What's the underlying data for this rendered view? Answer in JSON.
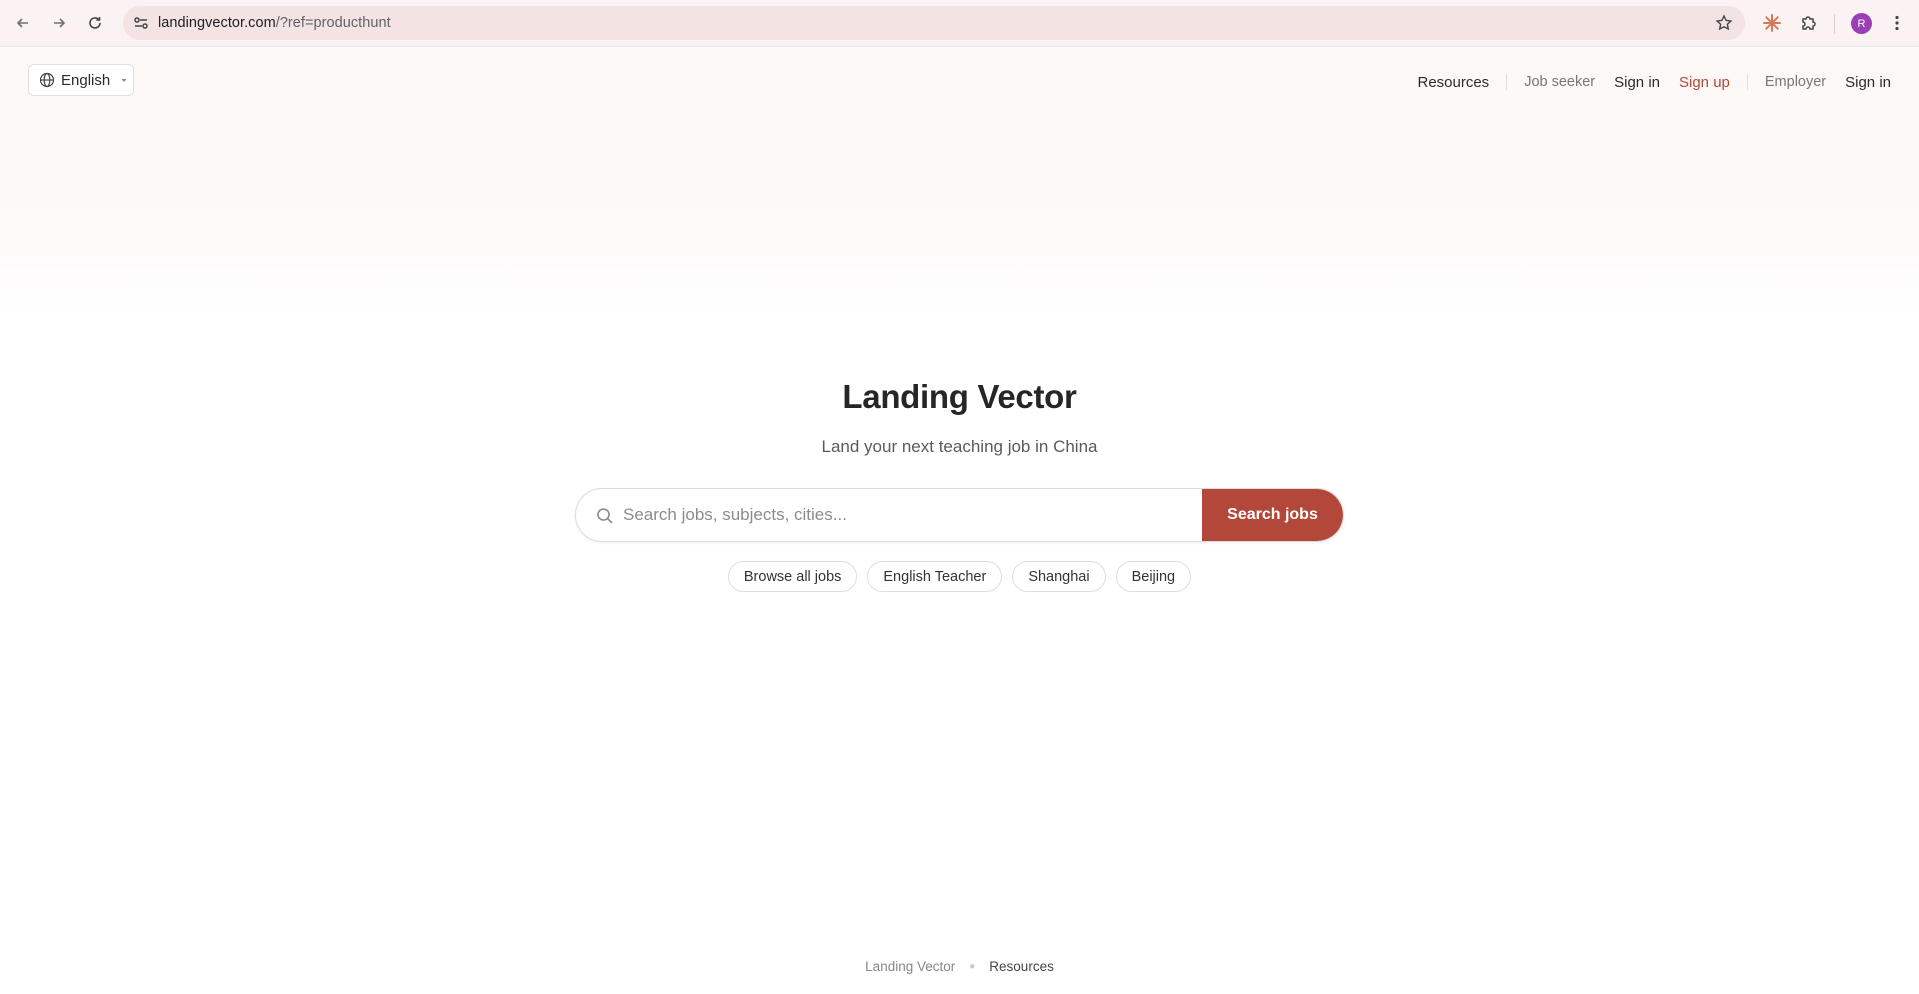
{
  "browser": {
    "url_host": "landingvector.com",
    "url_rest": "/?ref=producthunt",
    "avatar_initial": "R"
  },
  "header": {
    "language": "English",
    "nav": {
      "resources": "Resources",
      "job_seeker": "Job seeker",
      "job_seeker_sign_in": "Sign in",
      "sign_up": "Sign up",
      "employer": "Employer",
      "employer_sign_in": "Sign in"
    }
  },
  "hero": {
    "title": "Landing Vector",
    "subtitle": "Land your next teaching job in China"
  },
  "search": {
    "placeholder": "Search jobs, subjects, cities...",
    "button": "Search jobs"
  },
  "chips": [
    "Browse all jobs",
    "English Teacher",
    "Shanghai",
    "Beijing"
  ],
  "footer": {
    "brand": "Landing Vector",
    "resources": "Resources"
  },
  "colors": {
    "accent": "#b2473a",
    "avatar": "#9b3fb5"
  }
}
